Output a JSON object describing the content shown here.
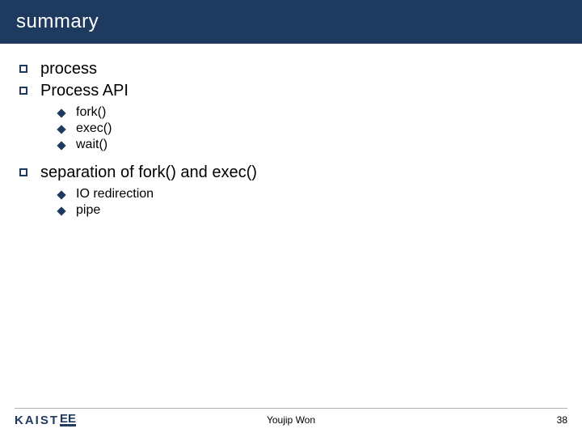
{
  "title": "summary",
  "bullets_top": [
    {
      "text": "process"
    },
    {
      "text": "Process API"
    }
  ],
  "sub_api": [
    {
      "text": "fork()"
    },
    {
      "text": "exec()"
    },
    {
      "text": "wait()"
    }
  ],
  "bullet_sep": {
    "text": "separation of fork() and exec()"
  },
  "sub_sep": [
    {
      "text": "IO redirection"
    },
    {
      "text": "pipe"
    }
  ],
  "footer": {
    "logo_main": "KAIST",
    "logo_sub": "EE",
    "author": "Youjip Won",
    "page": "38"
  }
}
